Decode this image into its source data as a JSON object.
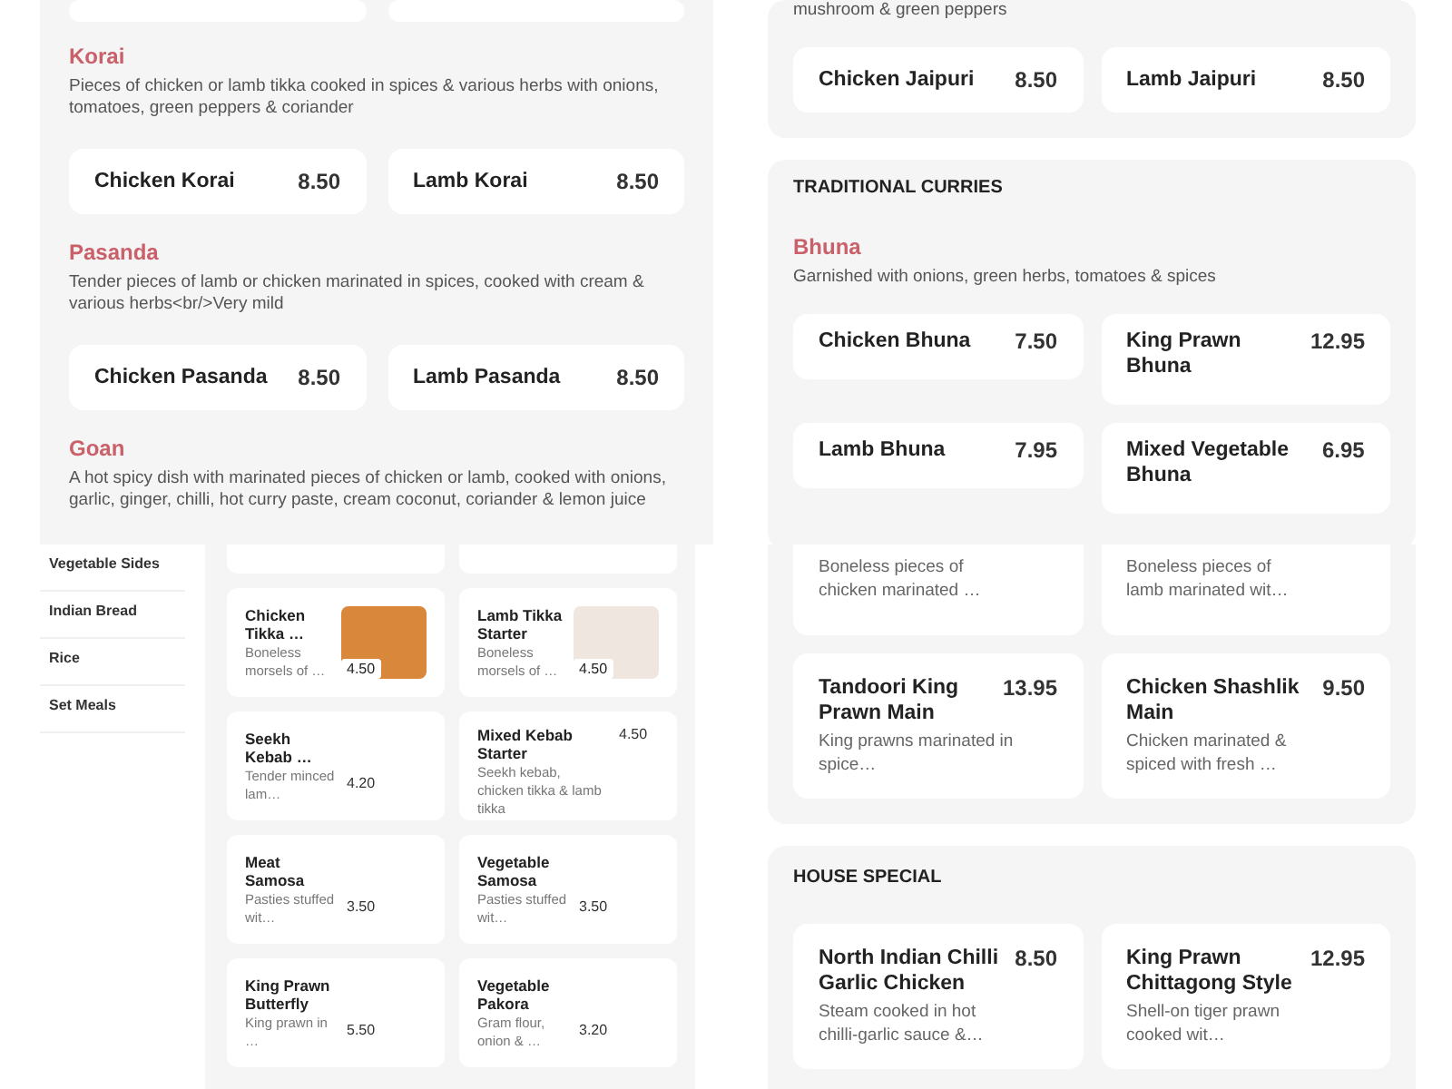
{
  "curries_panel": {
    "groups": [
      {
        "name": "Korai",
        "description": "Pieces of chicken or lamb tikka cooked in spices & various herbs with onions, tomatoes, green peppers & coriander",
        "items": [
          {
            "name": "Chicken Korai",
            "price": "8.50"
          },
          {
            "name": "Lamb Korai",
            "price": "8.50"
          }
        ]
      },
      {
        "name": "Pasanda",
        "description": "Tender pieces of lamb or chicken marinated in spices, cooked with cream & various herbs<br/>Very mild",
        "items": [
          {
            "name": "Chicken Pasanda",
            "price": "8.50"
          },
          {
            "name": "Lamb Pasanda",
            "price": "8.50"
          }
        ]
      },
      {
        "name": "Goan",
        "description": "A hot spicy dish with marinated pieces of chicken or lamb, cooked with onions, garlic, ginger, chilli, hot curry paste, cream coconut, coriander & lemon juice"
      }
    ]
  },
  "specials_panel": {
    "intro_tail": "mushroom & green peppers",
    "items": [
      {
        "name": "Chicken Jaipuri",
        "price": "8.50"
      },
      {
        "name": "Lamb Jaipuri",
        "price": "8.50"
      }
    ],
    "section": {
      "title": "TRADITIONAL CURRIES",
      "group": {
        "name": "Bhuna",
        "description": "Garnished with onions, green herbs, tomatoes & spices",
        "items": [
          {
            "name": "Chicken Bhuna",
            "price": "7.50"
          },
          {
            "name": "King Prawn Bhuna",
            "price": "12.95"
          },
          {
            "name": "Lamb Bhuna",
            "price": "7.95"
          },
          {
            "name": "Mixed Vegetable Bhuna",
            "price": "6.95"
          }
        ]
      }
    }
  },
  "starters_panel": {
    "sidebar": [
      "Vegetable Sides",
      "Indian Bread",
      "Rice",
      "Set Meals"
    ],
    "items": [
      {
        "kind": "photo",
        "name": "Chicken Tikka …",
        "description": "Boneless morsels of …",
        "price": "4.50"
      },
      {
        "kind": "photo",
        "name": "Lamb Tikka Starter",
        "description": "Boneless morsels of …",
        "price": "4.50"
      },
      {
        "kind": "plain",
        "name": "Seekh Kebab …",
        "description": "Tender minced lam…",
        "price": "4.20"
      },
      {
        "kind": "wide",
        "name": "Mixed Kebab Starter",
        "description": "Seekh kebab, chicken tikka & lamb tikka",
        "price": "4.50"
      },
      {
        "kind": "plain",
        "name": "Meat Samosa",
        "description": "Pasties stuffed wit…",
        "price": "3.50"
      },
      {
        "kind": "plain",
        "name": "Vegetable Samosa",
        "description": "Pasties stuffed wit…",
        "price": "3.50"
      },
      {
        "kind": "plain",
        "name": "King Prawn Butterfly",
        "description": "King prawn in …",
        "price": "5.50"
      },
      {
        "kind": "plain",
        "name": "Vegetable Pakora",
        "description": "Gram flour, onion & …",
        "price": "3.20"
      }
    ]
  },
  "tandoori_panel": {
    "cut_descriptions": [
      "Boneless pieces of chicken marinated …",
      "Boneless pieces of lamb marinated wit…"
    ],
    "items": [
      {
        "name": "Tandoori King Prawn Main",
        "price": "13.95",
        "description": "King prawns marinated in spice…"
      },
      {
        "name": "Chicken Shashlik Main",
        "price": "9.50",
        "description": "Chicken marinated & spiced with fresh …"
      }
    ],
    "section": {
      "title": "HOUSE SPECIAL",
      "items": [
        {
          "name": "North Indian Chilli Garlic Chicken",
          "price": "8.50",
          "description": "Steam cooked in hot chilli-garlic sauce &…"
        },
        {
          "name": "King Prawn Chittagong Style",
          "price": "12.95",
          "description": "Shell-on tiger prawn cooked wit…"
        }
      ]
    }
  }
}
